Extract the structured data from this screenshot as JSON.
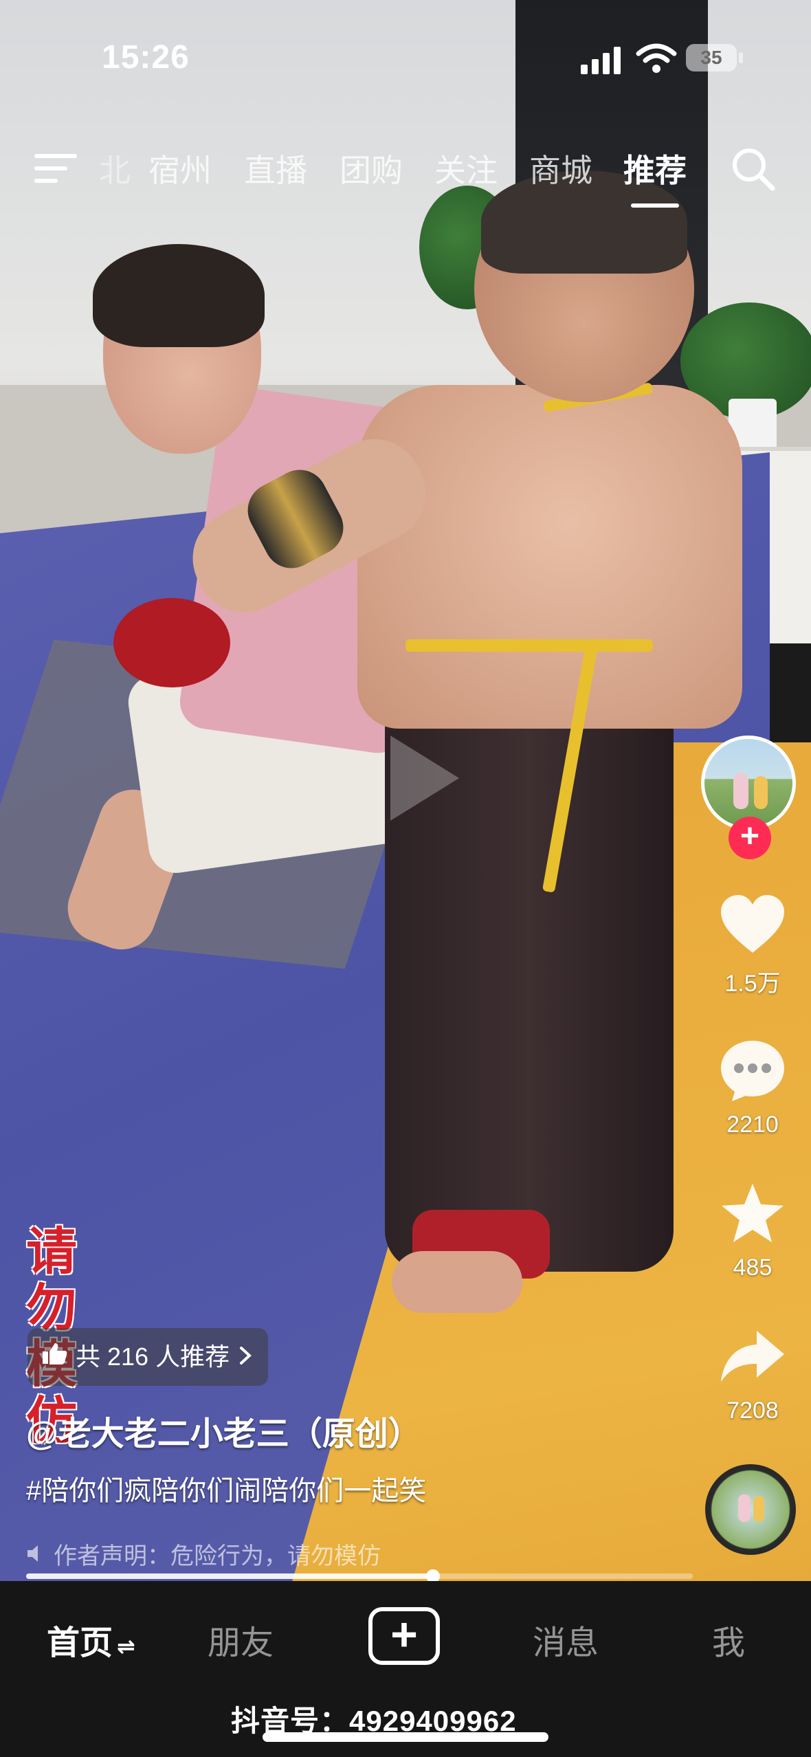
{
  "status_bar": {
    "time": "15:26",
    "battery": "35"
  },
  "top_nav": {
    "faded_tab": "北",
    "tabs": [
      {
        "label": "宿州",
        "active": false
      },
      {
        "label": "直播",
        "active": false
      },
      {
        "label": "团购",
        "active": false
      },
      {
        "label": "关注",
        "active": false
      },
      {
        "label": "商城",
        "active": false
      },
      {
        "label": "推荐",
        "active": true
      }
    ]
  },
  "right_rail": {
    "follow": "+",
    "like_count": "1.5万",
    "comment_count": "2210",
    "favorite_count": "485",
    "share_count": "7208"
  },
  "video": {
    "watermark": [
      "请",
      "勿",
      "模",
      "仿"
    ],
    "recommend_text": "共 216 人推荐",
    "author": "@老大老二小老三（原创）",
    "hashtag": "#陪你们疯陪你们闹陪你们一起笑",
    "disclaimer": "作者声明：危险行为，请勿模仿",
    "progress": 0.61
  },
  "bottom_bar": {
    "tabs": [
      {
        "label": "首页",
        "active": true
      },
      {
        "label": "朋友",
        "active": false
      },
      {
        "label": "消息",
        "active": false
      },
      {
        "label": "我",
        "active": false
      }
    ],
    "overlay_text": "抖音号：4929409962"
  },
  "colors": {
    "accent": "#fe2c55",
    "bar_bg": "#161616"
  },
  "icons": [
    "menu-icon",
    "search-icon",
    "heart-icon",
    "comment-icon",
    "star-icon",
    "share-icon",
    "thumbs-up-icon",
    "speaker-icon",
    "plus-icon",
    "chevron-right-icon"
  ]
}
